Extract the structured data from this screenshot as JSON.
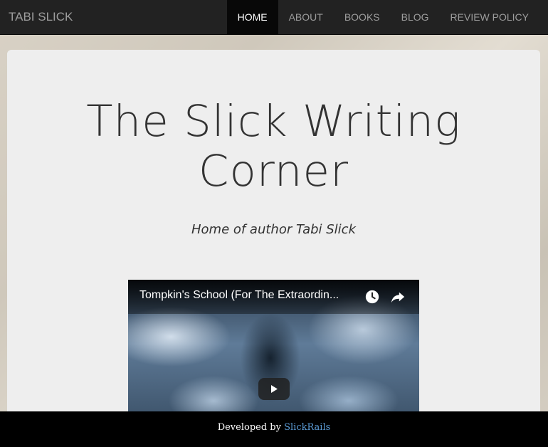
{
  "navbar": {
    "brand": "TABI SLICK",
    "items": [
      {
        "label": "HOME",
        "active": true
      },
      {
        "label": "ABOUT",
        "active": false
      },
      {
        "label": "BOOKS",
        "active": false
      },
      {
        "label": "BLOG",
        "active": false
      },
      {
        "label": "REVIEW POLICY",
        "active": false
      }
    ]
  },
  "hero": {
    "title": "The Slick Writing Corner",
    "subtitle": "Home of author Tabi Slick"
  },
  "video": {
    "title": "Tompkin's School (For The Extraordin...",
    "icons": [
      "watch-later-icon",
      "share-icon",
      "play-icon"
    ]
  },
  "footer": {
    "prefix": "Developed by ",
    "link": "SlickRails"
  },
  "colors": {
    "navbar_bg": "#222222",
    "nav_active_bg": "#080808",
    "nav_text": "#9d9d9d",
    "panel_bg": "#eeeeee",
    "footer_bg": "#000000",
    "footer_link": "#5b9bd5"
  }
}
